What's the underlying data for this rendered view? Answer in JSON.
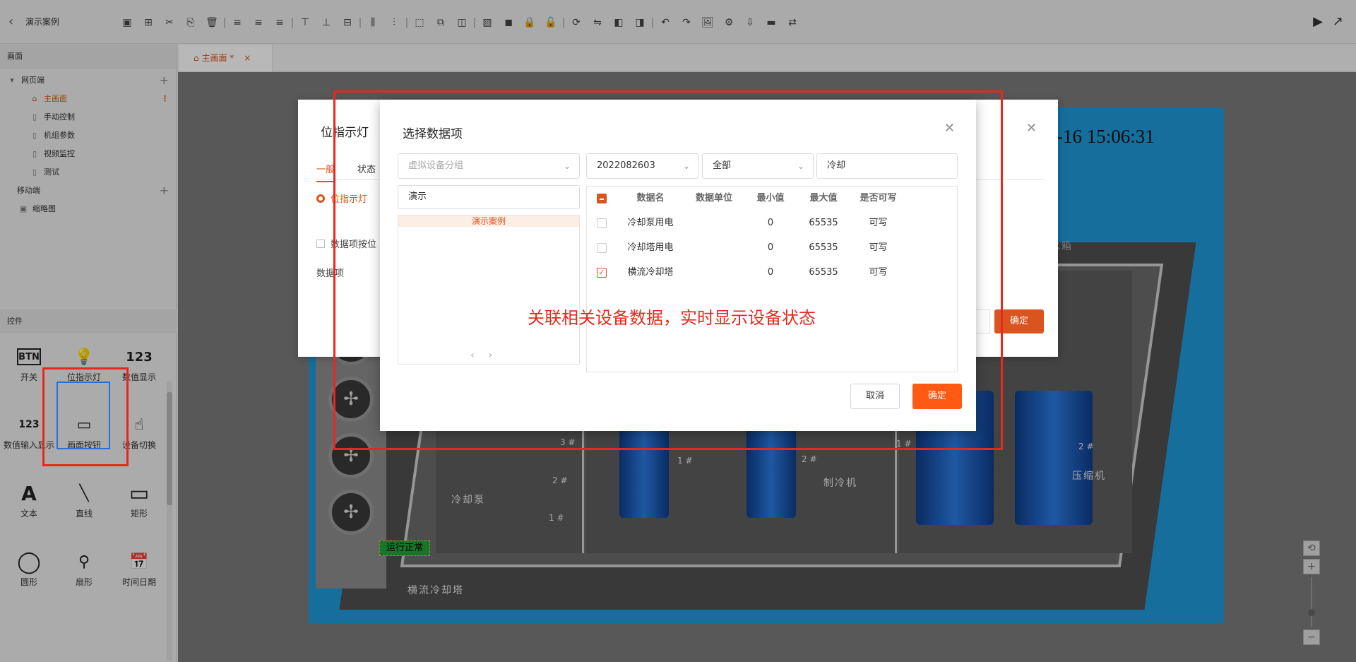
{
  "app": {
    "title": "演示案例",
    "back_icon": "chevron-left-icon"
  },
  "toolbar": {
    "icons": [
      "save-icon",
      "new-page-icon",
      "cut-icon",
      "paste-icon",
      "delete-icon",
      "sep",
      "align-left-icon",
      "align-center-icon",
      "align-right-icon",
      "sep",
      "align-top-icon",
      "align-bottom-icon",
      "align-middle-icon",
      "sep",
      "distribute-h-icon",
      "distribute-v-icon",
      "sep",
      "same-size-icon",
      "group-icon",
      "ungroup-icon",
      "sep",
      "bring-front-icon",
      "send-back-icon",
      "lock-icon",
      "unlock-icon",
      "sep",
      "rotate-icon",
      "flip-icon",
      "layer-up-icon",
      "layer-down-icon",
      "sep",
      "undo-icon",
      "redo-icon",
      "image-icon",
      "component-icon",
      "import-icon",
      "export-icon",
      "switch-icon"
    ],
    "right_icons": [
      "play-icon",
      "open-external-icon"
    ]
  },
  "sidebar": {
    "screen_section": "画面",
    "groups": [
      {
        "label": "网页端",
        "items": [
          {
            "label": "主画面",
            "active": true
          },
          {
            "label": "手动控制"
          },
          {
            "label": "机组参数"
          },
          {
            "label": "视频监控"
          },
          {
            "label": "测试"
          }
        ]
      },
      {
        "label": "移动端",
        "items": [
          {
            "label": "缩略图"
          }
        ]
      }
    ],
    "controls_section": "控件",
    "controls": [
      {
        "label": "开关",
        "glyph": "BTN"
      },
      {
        "label": "位指示灯",
        "glyph": "💡"
      },
      {
        "label": "数值显示",
        "glyph": "123"
      },
      {
        "label": "数值输入显示",
        "glyph": "123"
      },
      {
        "label": "画面按钮",
        "glyph": "▭"
      },
      {
        "label": "设备切换",
        "glyph": "☝"
      },
      {
        "label": "文本",
        "glyph": "A"
      },
      {
        "label": "直线",
        "glyph": "╲"
      },
      {
        "label": "矩形",
        "glyph": "▭"
      },
      {
        "label": "圆形",
        "glyph": "◯"
      },
      {
        "label": "扇形",
        "glyph": "⚲"
      },
      {
        "label": "时间日期",
        "glyph": "📅"
      }
    ]
  },
  "tabs": [
    {
      "label": "主画面 *",
      "close": "×"
    }
  ],
  "scene": {
    "clock": "-16 15:06:31",
    "labels": {
      "cooling_pump": "冷却泵",
      "chiller": "制冷机",
      "compressor": "压缩机",
      "cooling_tower": "横流冷却塔",
      "water_tank": "水箱"
    },
    "run_status": "运行正常",
    "numbers": [
      "3 #",
      "2 #",
      "1 #",
      "1 #",
      "2 #",
      "1 #",
      "2 #"
    ]
  },
  "dialog_behind": {
    "title": "位指示灯",
    "tab_general": "一般",
    "tab_status": "状态",
    "radio_label": "位指示灯",
    "checkbox_label": "数据项按位",
    "field_label": "数据项",
    "ok": "确定"
  },
  "dialog": {
    "title": "选择数据项",
    "group_select_placeholder": "虚拟设备分组",
    "device_select": "2022082603",
    "type_select": "全部",
    "keyword": "冷却",
    "tree_filter": "演示",
    "tree_item": "演示案例",
    "columns": [
      "数据名",
      "数据单位",
      "最小值",
      "最大值",
      "是否可写"
    ],
    "rows": [
      {
        "name": "冷却泵用电",
        "unit": "",
        "min": "0",
        "max": "65535",
        "writable": "可写",
        "checked": false
      },
      {
        "name": "冷却塔用电",
        "unit": "",
        "min": "0",
        "max": "65535",
        "writable": "可写",
        "checked": false
      },
      {
        "name": "横流冷却塔",
        "unit": "",
        "min": "0",
        "max": "65535",
        "writable": "可写",
        "checked": true
      }
    ],
    "annotation": "关联相关设备数据，实时显示设备状态",
    "cancel": "取消",
    "ok": "确定"
  },
  "colors": {
    "accent": "#d9541e",
    "ok_button": "#ff5a14",
    "highlight": "#e8281c",
    "scene_bg": "#1e99d8"
  }
}
